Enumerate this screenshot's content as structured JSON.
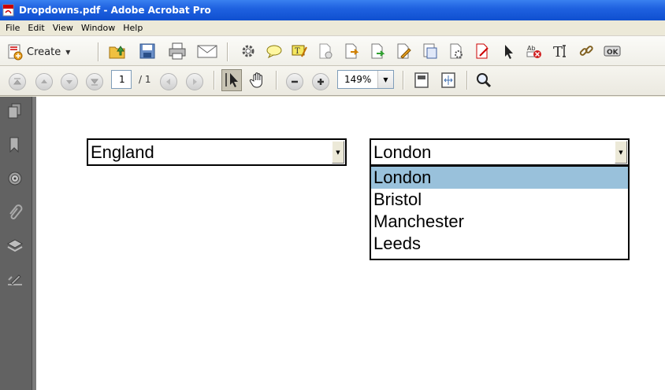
{
  "window": {
    "title": "Dropdowns.pdf - Adobe Acrobat Pro"
  },
  "menu": {
    "items": [
      "File",
      "Edit",
      "View",
      "Window",
      "Help"
    ]
  },
  "toolbar": {
    "create_label": "Create",
    "icons": [
      "open-folder-icon",
      "save-icon",
      "print-icon",
      "email-icon",
      "settings-gear-icon",
      "comment-bubble-icon",
      "highlight-text-icon",
      "attach-file-icon",
      "export-icon",
      "forward-arrow-icon",
      "sign-pen-icon",
      "document-stamp-icon",
      "document-settings-icon",
      "edit-form-icon",
      "select-arrow-icon",
      "delete-field-icon",
      "text-field-icon",
      "link-icon",
      "ok-button-icon"
    ]
  },
  "navigation": {
    "page_current": "1",
    "page_total": "/ 1",
    "zoom": "149%"
  },
  "sidebar": {
    "icons": [
      "pages-icon",
      "bookmarks-icon",
      "target-icon",
      "attachments-icon",
      "layers-icon",
      "signatures-icon"
    ]
  },
  "document": {
    "country_combo": {
      "value": "England"
    },
    "city_combo": {
      "value": "London",
      "options": [
        "London",
        "Bristol",
        "Manchester",
        "Leeds"
      ],
      "selected": "London"
    }
  },
  "colors": {
    "titlebar": "#1f62e0",
    "selected_option": "#99c1db",
    "sidebar": "#626262"
  }
}
